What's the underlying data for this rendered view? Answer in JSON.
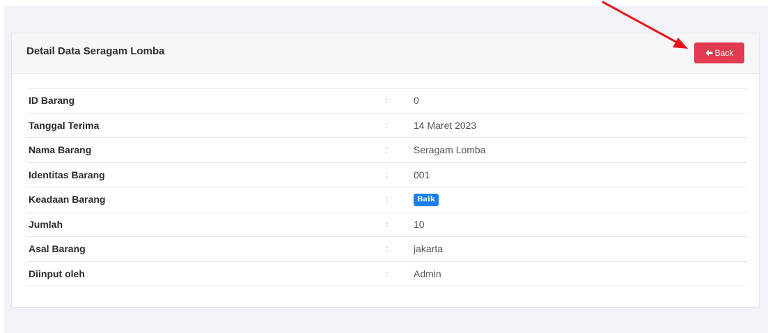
{
  "card": {
    "title": "Detail Data Seragam Lomba",
    "back_label": "Back"
  },
  "rows": [
    {
      "label": "ID Barang",
      "separator": ":",
      "value": "0"
    },
    {
      "label": "Tanggal Terima",
      "separator": ":",
      "value": "14 Maret 2023"
    },
    {
      "label": "Nama Barang",
      "separator": ":",
      "value": "Seragam Lomba"
    },
    {
      "label": "Identitas Barang",
      "separator": ":",
      "value": "001"
    },
    {
      "label": "Keadaan Barang",
      "separator": ":",
      "value": "Baik"
    },
    {
      "label": "Jumlah",
      "separator": ":",
      "value": "10"
    },
    {
      "label": "Asal Barang",
      "separator": ":",
      "value": "jakarta"
    },
    {
      "label": "Diinput oleh",
      "separator": ":",
      "value": "Admin"
    }
  ],
  "icons": {
    "back": "arrow-left-icon",
    "annotation": "red-arrow-annotation"
  },
  "colors": {
    "back_button": "#e23a4e",
    "badge": "#1a7ef0",
    "annotation": "#e8141c"
  }
}
